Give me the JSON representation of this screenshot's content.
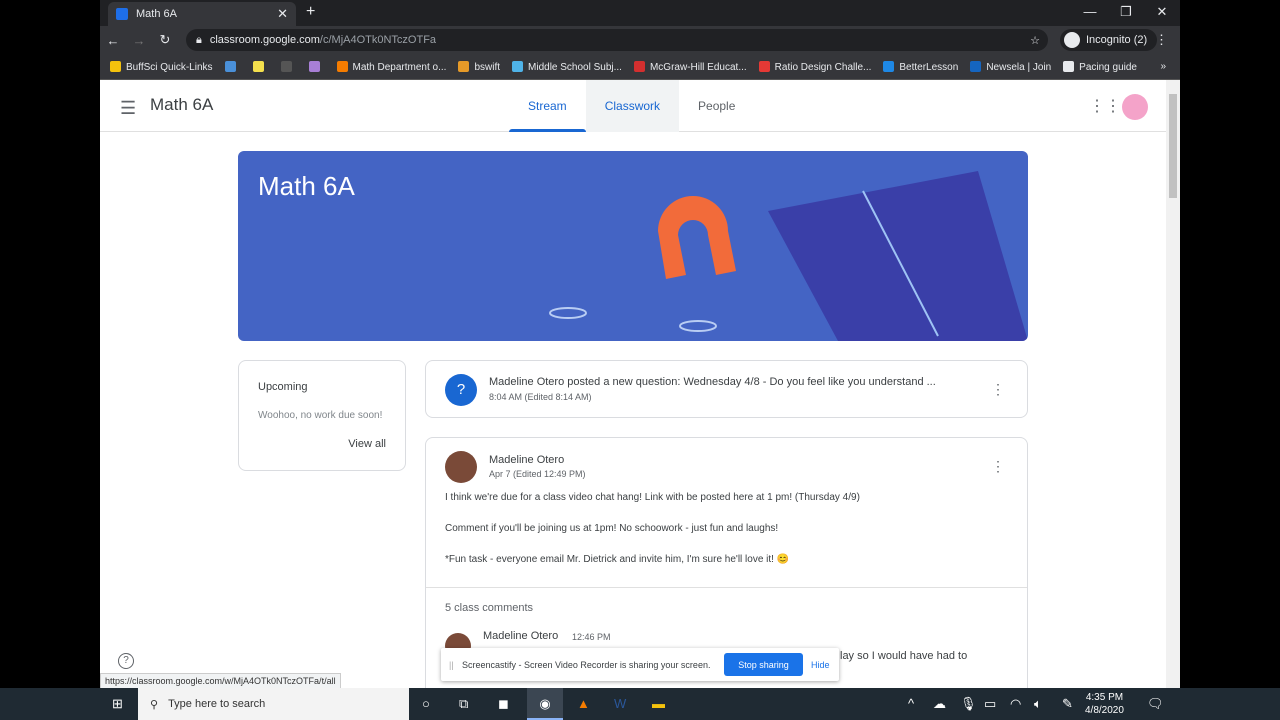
{
  "browser": {
    "tab_title": "Math 6A",
    "url_host": "classroom.google.com",
    "url_path": "/c/MjA4OTk0NTczOTFa",
    "profile": "Incognito (2)",
    "bookmarks": [
      {
        "label": "BuffSci Quick-Links",
        "color": "#f4c20d"
      },
      {
        "label": "",
        "color": "#4a90d9"
      },
      {
        "label": "",
        "color": "#f4e04d"
      },
      {
        "label": "",
        "color": "#555555"
      },
      {
        "label": "",
        "color": "#a87fd6"
      },
      {
        "label": "Math Department o...",
        "color": "#f57c00"
      },
      {
        "label": "bswift",
        "color": "#e69a28"
      },
      {
        "label": "Middle School Subj...",
        "color": "#4fb3e8"
      },
      {
        "label": "McGraw-Hill Educat...",
        "color": "#d32f2f"
      },
      {
        "label": "Ratio Design Challe...",
        "color": "#e53935"
      },
      {
        "label": "BetterLesson",
        "color": "#1e88e5"
      },
      {
        "label": "Newsela | Join",
        "color": "#1565c0"
      },
      {
        "label": "Pacing guide",
        "color": "#e8eaed"
      }
    ],
    "status_url": "https://classroom.google.com/w/MjA4OTk0NTczOTFa/t/all"
  },
  "header": {
    "title": "Math 6A",
    "tabs": [
      "Stream",
      "Classwork",
      "People"
    ]
  },
  "banner": {
    "title": "Math 6A",
    "color": "#4464c4"
  },
  "upcoming": {
    "title": "Upcoming",
    "empty": "Woohoo, no work due soon!",
    "view_all": "View all"
  },
  "posts": [
    {
      "text": "Madeline Otero posted a new question: Wednesday 4/8 - Do you feel like you understand ...",
      "time": "8:04 AM (Edited 8:14 AM)"
    },
    {
      "author": "Madeline Otero",
      "time": "Apr 7 (Edited 12:49 PM)",
      "lines": [
        "I think we're due for a class video chat hang! Link with be posted here at 1 pm! (Thursday 4/9)",
        "Comment if you'll be joining us at 1pm! No schoowork - just fun and laughs!",
        "*Fun task - everyone email Mr. Dietrick and invite him, I'm sure he'll love it! 😊"
      ],
      "comments_label": "5 class comments",
      "comment": {
        "author": "Madeline Otero",
        "time": "12:46 PM",
        "text_partial": "lay so I would have had to"
      }
    }
  ],
  "share_bar": {
    "text": "Screencastify - Screen Video Recorder is sharing your screen.",
    "stop": "Stop sharing",
    "hide": "Hide"
  },
  "taskbar": {
    "search": "Type here to search",
    "time": "4:35 PM",
    "date": "4/8/2020"
  }
}
